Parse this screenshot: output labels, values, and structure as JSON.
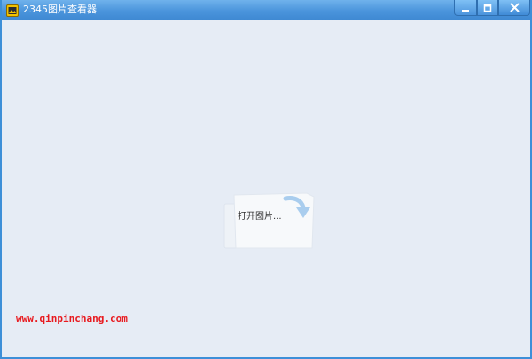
{
  "window": {
    "title": "2345图片查看器",
    "controls": {
      "minimize_icon": "minimize-icon",
      "maximize_icon": "maximize-icon",
      "close_icon": "close-icon"
    }
  },
  "main": {
    "open_label": "打开图片...",
    "open_icon": "folder-arrow-icon"
  },
  "watermark": {
    "text": "www.qinpinchang.com"
  },
  "colors": {
    "titlebar": "#4b95dc",
    "background": "#e6ecf5",
    "watermark": "#e8191e",
    "folder_arrow": "#a9cdee"
  }
}
